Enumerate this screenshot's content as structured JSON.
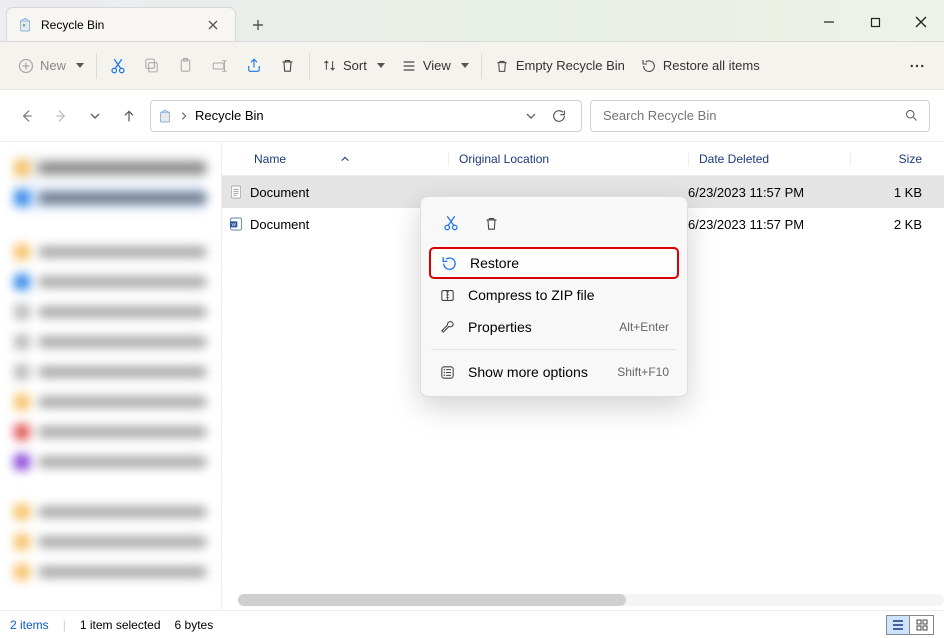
{
  "window": {
    "tab_title": "Recycle Bin"
  },
  "toolbar": {
    "new": "New",
    "sort": "Sort",
    "view": "View",
    "empty": "Empty Recycle Bin",
    "restore_all": "Restore all items"
  },
  "nav": {
    "breadcrumb": "Recycle Bin",
    "search_placeholder": "Search Recycle Bin"
  },
  "columns": {
    "name": "Name",
    "original": "Original Location",
    "deleted": "Date Deleted",
    "size": "Size"
  },
  "files": [
    {
      "name": "Document",
      "type": "txt",
      "deleted": "6/23/2023 11:57 PM",
      "size": "1 KB",
      "selected": true
    },
    {
      "name": "Document",
      "type": "docx",
      "deleted": "6/23/2023 11:57 PM",
      "size": "2 KB",
      "selected": false
    }
  ],
  "context_menu": {
    "restore": "Restore",
    "zip": "Compress to ZIP file",
    "properties": "Properties",
    "properties_kbd": "Alt+Enter",
    "more": "Show more options",
    "more_kbd": "Shift+F10"
  },
  "status": {
    "count": "2 items",
    "selection": "1 item selected",
    "bytes": "6 bytes"
  }
}
